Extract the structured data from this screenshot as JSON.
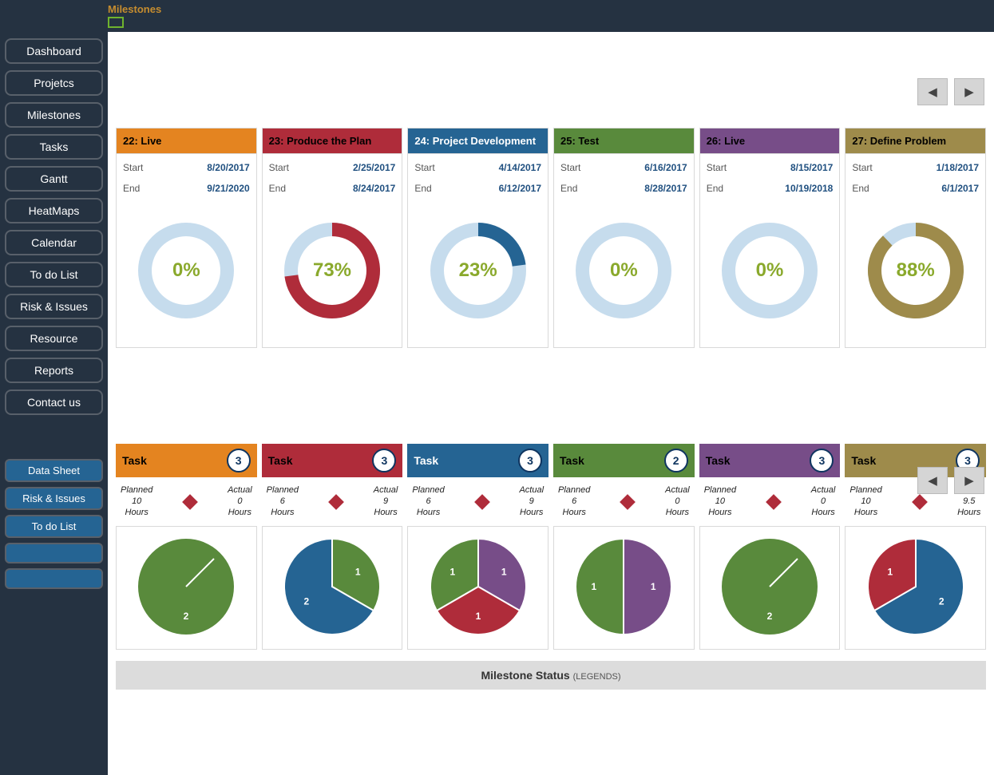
{
  "topbar": {
    "title": "Milestones"
  },
  "sidebar": {
    "nav": [
      "Dashboard",
      "Projetcs",
      "Milestones",
      "Tasks",
      "Gantt",
      "HeatMaps",
      "Calendar",
      "To do List",
      "Risk & Issues",
      "Resource",
      "Reports",
      "Contact us"
    ],
    "sub": [
      "Data Sheet",
      "Risk & Issues",
      "To do List",
      "",
      ""
    ]
  },
  "colors": {
    "orange": "#e48420",
    "red": "#af2c3a",
    "blue": "#256493",
    "green": "#598a3c",
    "purple": "#774d88",
    "olive": "#9e8b4b",
    "ring_bg": "#c6dced"
  },
  "milestones": [
    {
      "id": "22",
      "title": "Live",
      "hdr": "orange",
      "start": "8/20/2017",
      "end": "9/21/2020",
      "pct": 0
    },
    {
      "id": "23",
      "title": "Produce the Plan",
      "hdr": "red",
      "start": "2/25/2017",
      "end": "8/24/2017",
      "pct": 73
    },
    {
      "id": "24",
      "title": "Project Development",
      "hdr": "blue",
      "start": "4/14/2017",
      "end": "6/12/2017",
      "pct": 23
    },
    {
      "id": "25",
      "title": "Test",
      "hdr": "green",
      "start": "6/16/2017",
      "end": "8/28/2017",
      "pct": 0
    },
    {
      "id": "26",
      "title": "Live",
      "hdr": "purple",
      "start": "8/15/2017",
      "end": "10/19/2018",
      "pct": 0
    },
    {
      "id": "27",
      "title": "Define Problem",
      "hdr": "olive",
      "start": "1/18/2017",
      "end": "6/1/2017",
      "pct": 88
    }
  ],
  "tasks": [
    {
      "hdr": "orange",
      "label": "Task",
      "count": 3,
      "planned": "10",
      "actual": "0",
      "pie": [
        {
          "v": 2,
          "c": "green"
        }
      ],
      "lines": [
        [
          70,
          70,
          105,
          35
        ]
      ]
    },
    {
      "hdr": "red",
      "label": "Task",
      "count": 3,
      "planned": "6",
      "actual": "9",
      "pie": [
        {
          "v": 1,
          "c": "green"
        },
        {
          "v": 2,
          "c": "blue"
        }
      ]
    },
    {
      "hdr": "blue",
      "label": "Task",
      "count": 3,
      "planned": "6",
      "actual": "9",
      "pie": [
        {
          "v": 1,
          "c": "purple"
        },
        {
          "v": 1,
          "c": "red"
        },
        {
          "v": 1,
          "c": "green"
        }
      ]
    },
    {
      "hdr": "green",
      "label": "Task",
      "count": 2,
      "planned": "6",
      "actual": "0",
      "pie": [
        {
          "v": 1,
          "c": "purple"
        },
        {
          "v": 1,
          "c": "green"
        }
      ]
    },
    {
      "hdr": "purple",
      "label": "Task",
      "count": 3,
      "planned": "10",
      "actual": "0",
      "pie": [
        {
          "v": 2,
          "c": "green"
        }
      ],
      "lines": [
        [
          70,
          70,
          105,
          35
        ]
      ]
    },
    {
      "hdr": "olive",
      "label": "Task",
      "count": 3,
      "planned": "10",
      "actual": "9.5",
      "pie": [
        {
          "v": 2,
          "c": "blue"
        },
        {
          "v": 1,
          "c": "red"
        }
      ]
    }
  ],
  "labels": {
    "start": "Start",
    "end": "End",
    "task": "Task",
    "planned": "Planned",
    "actual": "Actual",
    "hours": "Hours",
    "legend_title": "Milestone Status",
    "legend_sub": "(LEGENDS)"
  },
  "chart_data": {
    "donuts": [
      {
        "type": "pie",
        "title": "22: Live",
        "values": [
          0,
          100
        ],
        "labels": [
          "complete",
          "remaining"
        ]
      },
      {
        "type": "pie",
        "title": "23: Produce the Plan",
        "values": [
          73,
          27
        ],
        "labels": [
          "complete",
          "remaining"
        ]
      },
      {
        "type": "pie",
        "title": "24: Project Development",
        "values": [
          23,
          77
        ],
        "labels": [
          "complete",
          "remaining"
        ]
      },
      {
        "type": "pie",
        "title": "25: Test",
        "values": [
          0,
          100
        ],
        "labels": [
          "complete",
          "remaining"
        ]
      },
      {
        "type": "pie",
        "title": "26: Live",
        "values": [
          0,
          100
        ],
        "labels": [
          "complete",
          "remaining"
        ]
      },
      {
        "type": "pie",
        "title": "27: Define Problem",
        "values": [
          88,
          12
        ],
        "labels": [
          "complete",
          "remaining"
        ]
      }
    ],
    "task_pies": [
      {
        "type": "pie",
        "series": [
          {
            "name": "green",
            "value": 2
          }
        ]
      },
      {
        "type": "pie",
        "series": [
          {
            "name": "green",
            "value": 1
          },
          {
            "name": "blue",
            "value": 2
          }
        ]
      },
      {
        "type": "pie",
        "series": [
          {
            "name": "purple",
            "value": 1
          },
          {
            "name": "red",
            "value": 1
          },
          {
            "name": "green",
            "value": 1
          }
        ]
      },
      {
        "type": "pie",
        "series": [
          {
            "name": "purple",
            "value": 1
          },
          {
            "name": "green",
            "value": 1
          }
        ]
      },
      {
        "type": "pie",
        "series": [
          {
            "name": "green",
            "value": 2
          }
        ]
      },
      {
        "type": "pie",
        "series": [
          {
            "name": "blue",
            "value": 2
          },
          {
            "name": "red",
            "value": 1
          }
        ]
      }
    ]
  }
}
